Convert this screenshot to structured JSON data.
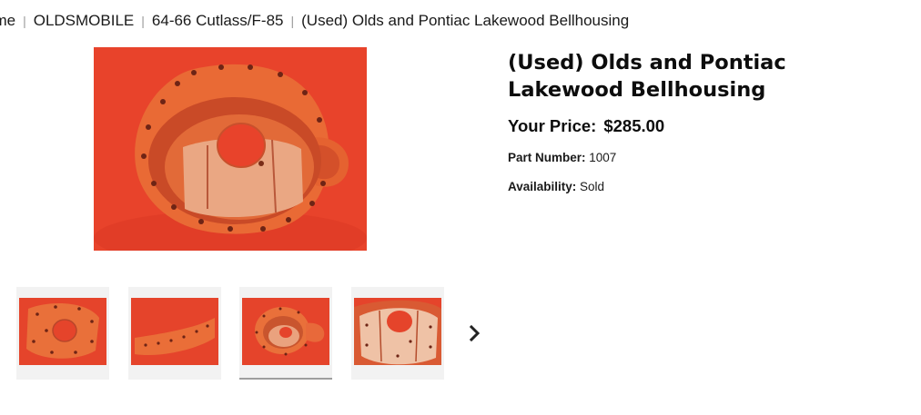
{
  "breadcrumb": [
    {
      "label": "ome"
    },
    {
      "label": "OLDSMOBILE"
    },
    {
      "label": "64-66 Cutlass/F-85"
    },
    {
      "label": "(Used) Olds and Pontiac Lakewood Bellhousing"
    }
  ],
  "breadcrumb_separator": "|",
  "product": {
    "title": "(Used) Olds and Pontiac Lakewood Bellhousing",
    "price_label": "Your Price:",
    "price": "$285.00",
    "part_number_label": "Part Number:",
    "part_number": "1007",
    "availability_label": "Availability:",
    "availability": "Sold"
  },
  "thumbnails": [
    {
      "icon": "bellhousing-front-photo"
    },
    {
      "icon": "bellhousing-side-photo"
    },
    {
      "icon": "bellhousing-top-photo",
      "selected": true
    },
    {
      "icon": "bellhousing-inside-photo"
    }
  ],
  "icons": {
    "next": "chevron-right-icon"
  },
  "colors": {
    "photo_background": "#e8432b",
    "part_color": "#e8652f"
  }
}
